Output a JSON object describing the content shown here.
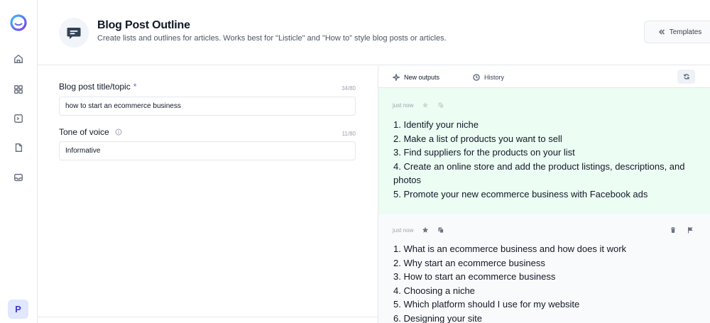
{
  "header": {
    "title": "Blog Post Outline",
    "subtitle": "Create lists and outlines for articles. Works best for \"Listicle\" and \"How to\" style blog posts or articles.",
    "templates_label": "Templates"
  },
  "sidebar": {
    "items": [
      {
        "icon": "home-icon"
      },
      {
        "icon": "grid-icon"
      },
      {
        "icon": "terminal-icon"
      },
      {
        "icon": "document-icon"
      },
      {
        "icon": "inbox-icon"
      }
    ],
    "avatar_letter": "P"
  },
  "form": {
    "title_label": "Blog post title/topic",
    "title_required": "*",
    "title_count": "34/80",
    "title_value": "how to start an ecommerce business",
    "tone_label": "Tone of voice",
    "tone_count": "11/80",
    "tone_value": "Informative"
  },
  "outputs": {
    "tab_new": "New outputs",
    "tab_history": "History",
    "cards": [
      {
        "time": "just now",
        "lines": [
          "1. Identify your niche",
          "2. Make a list of products you want to sell",
          "3. Find suppliers for the products on your list",
          "4. Create an online store and add the product listings, descriptions, and photos",
          "5. Promote your new ecommerce business with Facebook ads"
        ]
      },
      {
        "time": "just now",
        "lines": [
          "1. What is an ecommerce business and how does it work",
          "2. Why start an ecommerce business",
          "3. How to start an ecommerce business",
          "4. Choosing a niche",
          "5. Which platform should I use for my website",
          "6. Designing your site"
        ]
      }
    ]
  },
  "colors": {
    "accent": "#6366f1",
    "card_highlight": "#ecfdf3",
    "header_icon": "#334155"
  }
}
